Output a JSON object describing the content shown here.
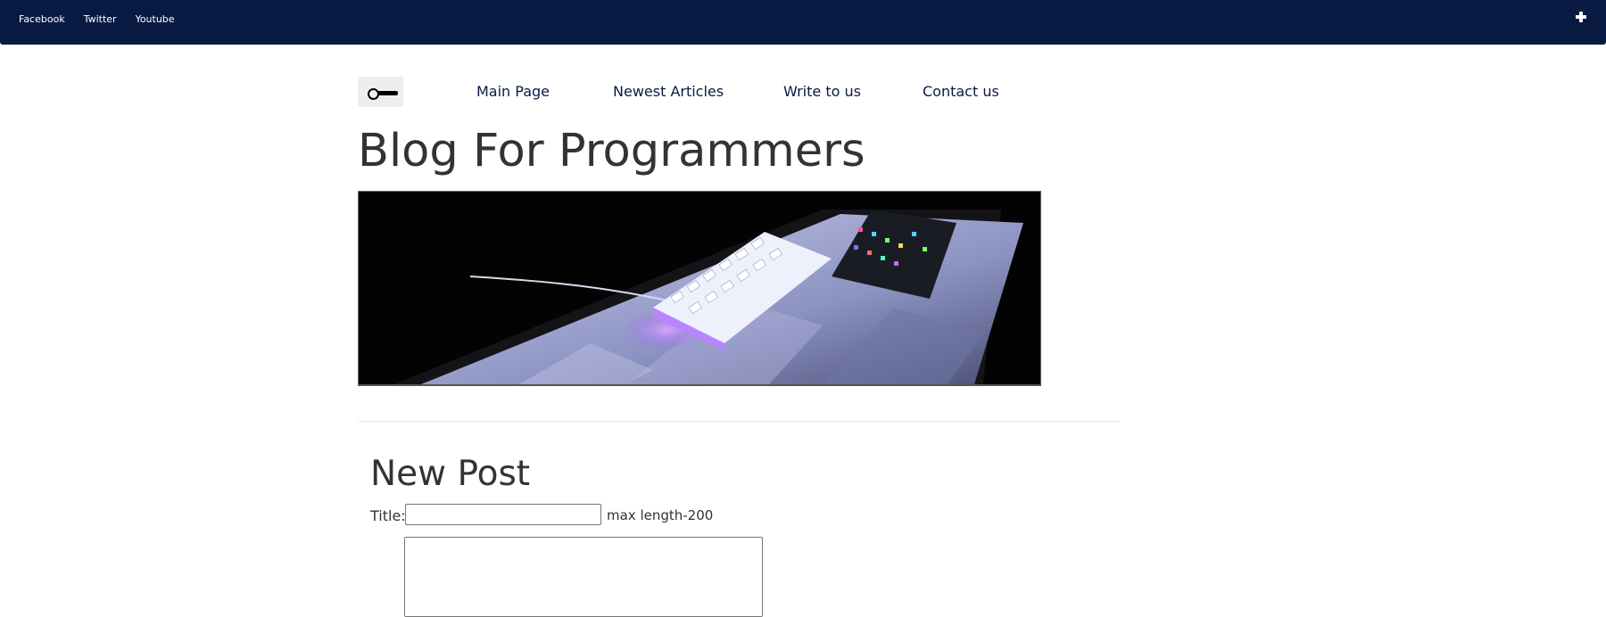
{
  "topbar": {
    "social_links": [
      "Facebook",
      "Twitter",
      "Youtube"
    ],
    "expand_icon": "plus-icon",
    "background_color": "#081a42"
  },
  "nav": {
    "theme_toggle_icon": "toggle-icon",
    "links": [
      "Main Page",
      "Newest Articles",
      "Write to us",
      "Contact us"
    ]
  },
  "site_title": "Blog For Programmers",
  "hero": {
    "alt": "Two mechanical keyboards on a desk mat"
  },
  "new_post": {
    "heading": "New Post",
    "title_label": "Title:",
    "title_value": "",
    "max_length_note": "max length-200",
    "body_value": ""
  }
}
